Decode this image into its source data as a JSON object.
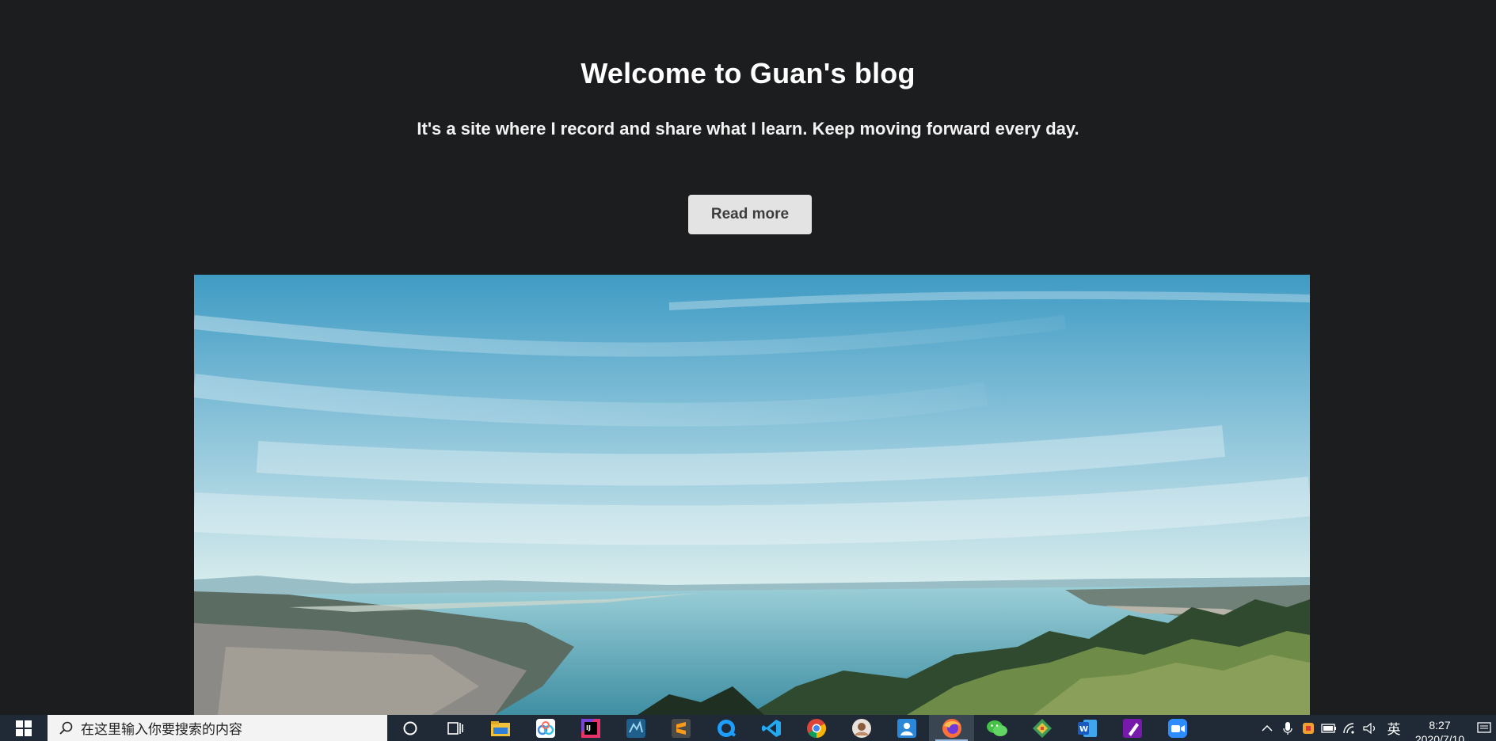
{
  "hero": {
    "title": "Welcome to Guan's blog",
    "subtitle": "It's a site where I record and share what I learn. Keep moving forward every day.",
    "button_label": "Read more"
  },
  "taskbar": {
    "search_placeholder": "在这里输入你要搜索的内容",
    "apps": [
      {
        "name": "cortana-icon"
      },
      {
        "name": "task-view-icon"
      },
      {
        "name": "file-explorer-icon"
      },
      {
        "name": "baidu-netdisk-icon"
      },
      {
        "name": "intellij-idea-icon"
      },
      {
        "name": "mysql-workbench-icon"
      },
      {
        "name": "sublime-text-icon"
      },
      {
        "name": "qq-browser-icon"
      },
      {
        "name": "vscode-icon"
      },
      {
        "name": "chrome-icon"
      },
      {
        "name": "avatar-app-icon"
      },
      {
        "name": "photo-app-icon"
      },
      {
        "name": "firefox-icon",
        "active": true
      },
      {
        "name": "wechat-icon"
      },
      {
        "name": "diagram-app-icon"
      },
      {
        "name": "word-icon"
      },
      {
        "name": "onenote-icon"
      },
      {
        "name": "zoom-icon"
      }
    ],
    "tray": {
      "language": "英",
      "time": "8:27",
      "date": "2020/7/10"
    }
  },
  "colors": {
    "background": "#1c1d1f",
    "button_bg": "#e3e3e4",
    "taskbar_bg": "#1f2a36"
  }
}
